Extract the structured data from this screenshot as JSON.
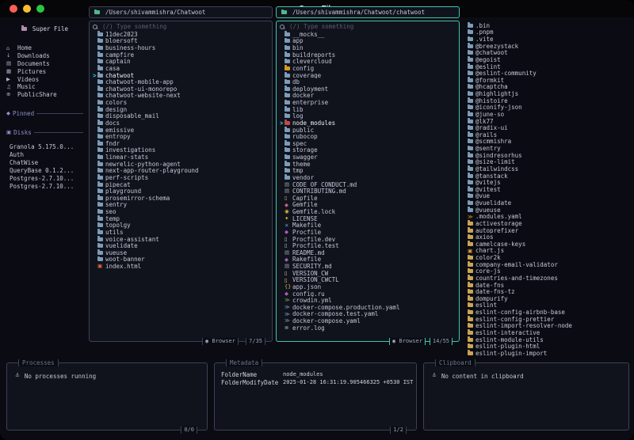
{
  "window": {
    "title": "SuperFile",
    "traffic_lights": [
      "#ff5f57",
      "#febc2e",
      "#28c840"
    ]
  },
  "colors": {
    "bg": "#0b0c13",
    "panel": "#11131c",
    "border": "#3a4156",
    "accent": "#3ec6ae",
    "text": "#c3c8d8",
    "dim": "#565d75",
    "cursor": "#35c3dd"
  },
  "sidebar": {
    "logo_label": "Super File",
    "items": [
      {
        "name": "Home",
        "icon": "home"
      },
      {
        "name": "Downloads",
        "icon": "downloads"
      },
      {
        "name": "Documents",
        "icon": "documents"
      },
      {
        "name": "Pictures",
        "icon": "pictures"
      },
      {
        "name": "Videos",
        "icon": "videos"
      },
      {
        "name": "Music",
        "icon": "music"
      },
      {
        "name": "PublicShare",
        "icon": "share"
      }
    ],
    "pinned_label": "Pinned",
    "disks_label": "Disks",
    "disks": [
      {
        "name": "Granola 5.175.0..."
      },
      {
        "name": "Auth"
      },
      {
        "name": "ChatWise"
      },
      {
        "name": "QueryBase 0.1.2..."
      },
      {
        "name": "Postgres-2.7.10..."
      },
      {
        "name": "Postgres-2.7.10..."
      }
    ]
  },
  "panels": [
    {
      "path": "/Users/shivammishra/Chatwoot",
      "search_placeholder": "(/) Type something",
      "browser_label": "Browser",
      "page": "7/35",
      "files": [
        {
          "name": "11dec2023",
          "icon": "folder"
        },
        {
          "name": "bloersoft",
          "icon": "folder"
        },
        {
          "name": "business-hours",
          "icon": "folder"
        },
        {
          "name": "campfire",
          "icon": "folder"
        },
        {
          "name": "captain",
          "icon": "folder"
        },
        {
          "name": "casa",
          "icon": "folder"
        },
        {
          "name": "chatwoot",
          "icon": "folder",
          "selected": true
        },
        {
          "name": "chatwoot-mobile-app",
          "icon": "folder"
        },
        {
          "name": "chatwoot-ui-monorepo",
          "icon": "folder"
        },
        {
          "name": "chatwoot-website-next",
          "icon": "folder"
        },
        {
          "name": "colors",
          "icon": "folder"
        },
        {
          "name": "design",
          "icon": "folder"
        },
        {
          "name": "disposable_mail",
          "icon": "folder"
        },
        {
          "name": "docs",
          "icon": "folder"
        },
        {
          "name": "emissive",
          "icon": "folder"
        },
        {
          "name": "entropy",
          "icon": "folder"
        },
        {
          "name": "fndr",
          "icon": "folder"
        },
        {
          "name": "investigations",
          "icon": "folder"
        },
        {
          "name": "linear-stats",
          "icon": "folder"
        },
        {
          "name": "newrelic-python-agent",
          "icon": "folder"
        },
        {
          "name": "next-app-router-playground",
          "icon": "folder"
        },
        {
          "name": "perf-scripts",
          "icon": "folder"
        },
        {
          "name": "pipecat",
          "icon": "folder"
        },
        {
          "name": "playground",
          "icon": "folder"
        },
        {
          "name": "prosemirror-schema",
          "icon": "folder"
        },
        {
          "name": "sentry",
          "icon": "folder"
        },
        {
          "name": "seo",
          "icon": "folder"
        },
        {
          "name": "temp",
          "icon": "folder"
        },
        {
          "name": "topolgy",
          "icon": "folder"
        },
        {
          "name": "utils",
          "icon": "folder"
        },
        {
          "name": "voice-assistant",
          "icon": "folder"
        },
        {
          "name": "vuelidate",
          "icon": "folder"
        },
        {
          "name": "vueuse",
          "icon": "folder"
        },
        {
          "name": "woot-banner",
          "icon": "folder"
        },
        {
          "name": "index.html",
          "icon": "html",
          "color": "#e06c3a"
        }
      ]
    },
    {
      "path": "/Users/shivammishra/Chatwoot/chatwoot",
      "search_placeholder": "(/) Type something",
      "browser_label": "Browser",
      "page": "14/55",
      "files": [
        {
          "name": "__mocks__",
          "icon": "folder"
        },
        {
          "name": "app",
          "icon": "folder"
        },
        {
          "name": "bin",
          "icon": "folder"
        },
        {
          "name": "buildreports",
          "icon": "folder"
        },
        {
          "name": "clevercloud",
          "icon": "folder"
        },
        {
          "name": "config",
          "icon": "folder",
          "color": "#d79921"
        },
        {
          "name": "coverage",
          "icon": "folder"
        },
        {
          "name": "db",
          "icon": "folder"
        },
        {
          "name": "deployment",
          "icon": "folder"
        },
        {
          "name": "docker",
          "icon": "folder"
        },
        {
          "name": "enterprise",
          "icon": "folder"
        },
        {
          "name": "lib",
          "icon": "folder"
        },
        {
          "name": "log",
          "icon": "folder"
        },
        {
          "name": "node_modules",
          "icon": "folder",
          "color": "#bf4a4a",
          "selected": true
        },
        {
          "name": "public",
          "icon": "folder"
        },
        {
          "name": "rubocop",
          "icon": "folder"
        },
        {
          "name": "spec",
          "icon": "folder"
        },
        {
          "name": "storage",
          "icon": "folder"
        },
        {
          "name": "swagger",
          "icon": "folder"
        },
        {
          "name": "theme",
          "icon": "folder"
        },
        {
          "name": "tmp",
          "icon": "folder"
        },
        {
          "name": "vendor",
          "icon": "folder"
        },
        {
          "name": "CODE_OF_CONDUCT.md",
          "icon": "md",
          "color": "#8fa0b3"
        },
        {
          "name": "CONTRIBUTING.md",
          "icon": "md",
          "color": "#8fa0b3"
        },
        {
          "name": "Capfile",
          "icon": "file",
          "color": "#d5b97e"
        },
        {
          "name": "Gemfile",
          "icon": "gem",
          "color": "#c65f8f"
        },
        {
          "name": "Gemfile.lock",
          "icon": "lock",
          "color": "#e3b341"
        },
        {
          "name": "LICENSE",
          "icon": "key",
          "color": "#e3b341"
        },
        {
          "name": "Makefile",
          "icon": "make",
          "color": "#5f9ded"
        },
        {
          "name": "Procfile",
          "icon": "gem",
          "color": "#a85fc0"
        },
        {
          "name": "Procfile.dev",
          "icon": "file",
          "color": "#c8cede"
        },
        {
          "name": "Procfile.test",
          "icon": "file",
          "color": "#c8cede"
        },
        {
          "name": "README.md",
          "icon": "md",
          "color": "#8fa0b3"
        },
        {
          "name": "Rakefile",
          "icon": "gem",
          "color": "#a85fc0"
        },
        {
          "name": "SECURITY.md",
          "icon": "md",
          "color": "#8fa0b3"
        },
        {
          "name": "VERSION_CW",
          "icon": "file",
          "color": "#e3c78a"
        },
        {
          "name": "VERSION_CWCTL",
          "icon": "file",
          "color": "#e3c78a"
        },
        {
          "name": "app.json",
          "icon": "json",
          "color": "#e3b341"
        },
        {
          "name": "config.ru",
          "icon": "gem",
          "color": "#a85fc0"
        },
        {
          "name": "crowdin.yml",
          "icon": "yml",
          "color": "#6aa84f"
        },
        {
          "name": "docker-compose.production.yaml",
          "icon": "yml",
          "color": "#6e9cc2"
        },
        {
          "name": "docker-compose.test.yaml",
          "icon": "yml",
          "color": "#6e9cc2"
        },
        {
          "name": "docker-compose.yaml",
          "icon": "yml",
          "color": "#6e9cc2"
        },
        {
          "name": "error.log",
          "icon": "log",
          "color": "#98a0b0"
        }
      ]
    }
  ],
  "preview": {
    "files": [
      {
        "name": ".bin",
        "icon": "folder"
      },
      {
        "name": ".pnpm",
        "icon": "folder"
      },
      {
        "name": ".vite",
        "icon": "folder"
      },
      {
        "name": "@breezystack",
        "icon": "folder"
      },
      {
        "name": "@chatwoot",
        "icon": "folder"
      },
      {
        "name": "@egoist",
        "icon": "folder"
      },
      {
        "name": "@eslint",
        "icon": "folder"
      },
      {
        "name": "@eslint-community",
        "icon": "folder"
      },
      {
        "name": "@formkit",
        "icon": "folder"
      },
      {
        "name": "@hcaptcha",
        "icon": "folder"
      },
      {
        "name": "@highlightjs",
        "icon": "folder"
      },
      {
        "name": "@histoire",
        "icon": "folder"
      },
      {
        "name": "@iconify-json",
        "icon": "folder"
      },
      {
        "name": "@june-so",
        "icon": "folder"
      },
      {
        "name": "@lk77",
        "icon": "folder"
      },
      {
        "name": "@radix-ui",
        "icon": "folder"
      },
      {
        "name": "@rails",
        "icon": "folder"
      },
      {
        "name": "@scmmishra",
        "icon": "folder"
      },
      {
        "name": "@sentry",
        "icon": "folder"
      },
      {
        "name": "@sindresorhus",
        "icon": "folder"
      },
      {
        "name": "@size-limit",
        "icon": "folder"
      },
      {
        "name": "@tailwindcss",
        "icon": "folder"
      },
      {
        "name": "@tanstack",
        "icon": "folder"
      },
      {
        "name": "@vitejs",
        "icon": "folder"
      },
      {
        "name": "@vitest",
        "icon": "folder"
      },
      {
        "name": "@vue",
        "icon": "folder"
      },
      {
        "name": "@vuelidate",
        "icon": "folder"
      },
      {
        "name": "@vueuse",
        "icon": "folder"
      },
      {
        "name": ".modules.yaml",
        "icon": "yml",
        "color": "#d79921"
      },
      {
        "name": "activestorage",
        "icon": "folder",
        "color": "#c9a554"
      },
      {
        "name": "autoprefixer",
        "icon": "folder",
        "color": "#c9a554"
      },
      {
        "name": "axios",
        "icon": "folder",
        "color": "#c9a554"
      },
      {
        "name": "camelcase-keys",
        "icon": "folder",
        "color": "#c9a554"
      },
      {
        "name": "chart.js",
        "icon": "js",
        "color": "#e8a33d"
      },
      {
        "name": "color2k",
        "icon": "folder",
        "color": "#c9a554"
      },
      {
        "name": "company-email-validator",
        "icon": "folder",
        "color": "#c9a554"
      },
      {
        "name": "core-js",
        "icon": "folder",
        "color": "#c9a554"
      },
      {
        "name": "countries-and-timezones",
        "icon": "folder",
        "color": "#c9a554"
      },
      {
        "name": "date-fns",
        "icon": "folder",
        "color": "#c9a554"
      },
      {
        "name": "date-fns-tz",
        "icon": "folder",
        "color": "#c9a554"
      },
      {
        "name": "dompurify",
        "icon": "folder",
        "color": "#c9a554"
      },
      {
        "name": "eslint",
        "icon": "folder",
        "color": "#c9a554"
      },
      {
        "name": "eslint-config-airbnb-base",
        "icon": "folder",
        "color": "#c9a554"
      },
      {
        "name": "eslint-config-prettier",
        "icon": "folder",
        "color": "#c9a554"
      },
      {
        "name": "eslint-import-resolver-node",
        "icon": "folder",
        "color": "#c9a554"
      },
      {
        "name": "eslint-interactive",
        "icon": "folder",
        "color": "#c9a554"
      },
      {
        "name": "eslint-module-utils",
        "icon": "folder",
        "color": "#c9a554"
      },
      {
        "name": "eslint-plugin-html",
        "icon": "folder",
        "color": "#c9a554"
      },
      {
        "name": "eslint-plugin-import",
        "icon": "folder",
        "color": "#c9a554"
      }
    ]
  },
  "bottom": {
    "processes": {
      "title": "Processes",
      "empty": "No processes running",
      "page": "0/0"
    },
    "metadata": {
      "title": "Metadata",
      "page": "1/2",
      "rows": [
        [
          "FolderName",
          "node_modules"
        ],
        [
          "FolderModifyDate",
          "2025-01-28 16:31:19.905466325 +0530 IST"
        ]
      ]
    },
    "clipboard": {
      "title": "Clipboard",
      "empty": "No content in clipboard"
    }
  }
}
